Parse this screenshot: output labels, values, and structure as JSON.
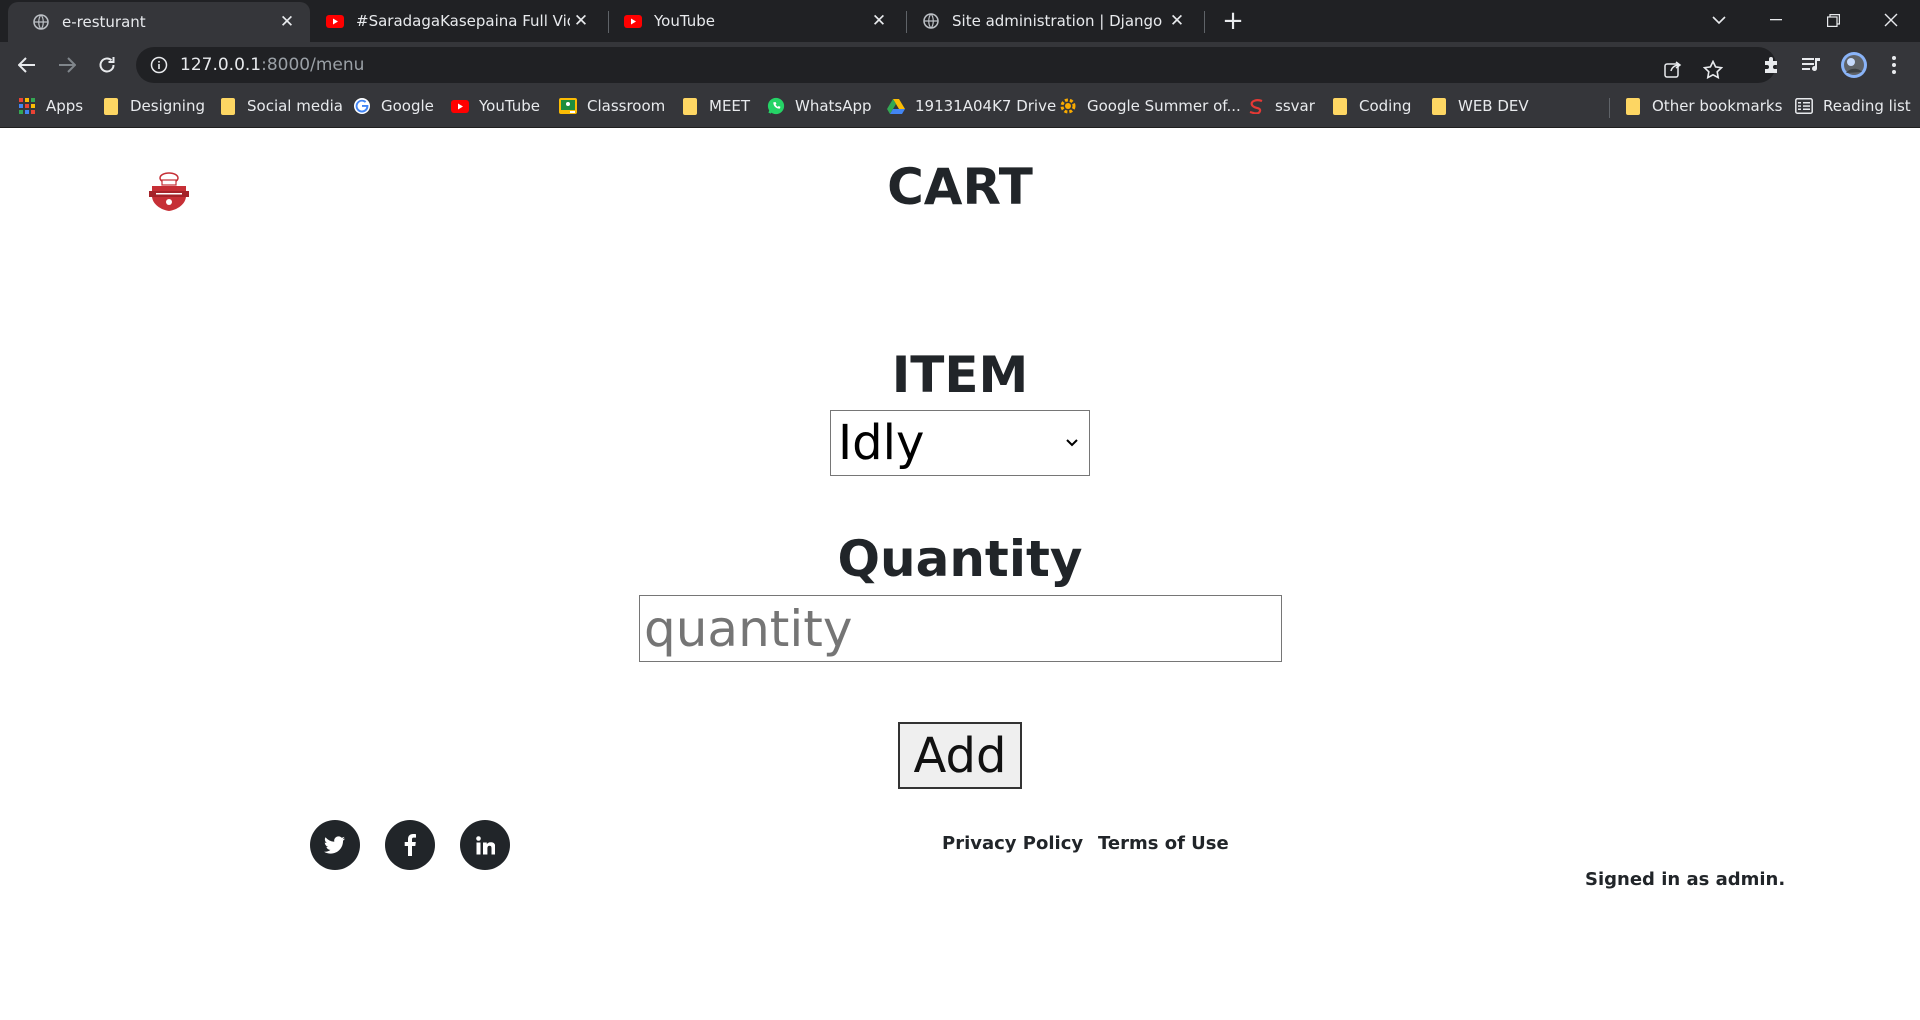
{
  "tabs": [
    {
      "title": "e-resturant",
      "icon": "globe-icon",
      "active": true
    },
    {
      "title": "#SaradagaKasepaina Full Video S",
      "icon": "youtube-icon",
      "active": false
    },
    {
      "title": "YouTube",
      "icon": "youtube-icon",
      "active": false
    },
    {
      "title": "Site administration | Django site a",
      "icon": "globe-icon",
      "active": false
    }
  ],
  "address_bar": {
    "host": "127.0.0.1",
    "path": ":8000/menu"
  },
  "bookmarks": [
    {
      "label": "Apps",
      "icon": "apps-grid-icon"
    },
    {
      "label": "Designing",
      "icon": "folder-icon"
    },
    {
      "label": "Social media",
      "icon": "folder-icon"
    },
    {
      "label": "Google",
      "icon": "google-icon"
    },
    {
      "label": "YouTube",
      "icon": "youtube-icon"
    },
    {
      "label": "Classroom",
      "icon": "classroom-icon"
    },
    {
      "label": "MEET",
      "icon": "folder-icon"
    },
    {
      "label": "WhatsApp",
      "icon": "whatsapp-icon"
    },
    {
      "label": "19131A04K7 Drive",
      "icon": "drive-icon"
    },
    {
      "label": "Google Summer of...",
      "icon": "gsoc-icon"
    },
    {
      "label": "ssvar",
      "icon": "ssvar-icon"
    },
    {
      "label": "Coding",
      "icon": "folder-icon"
    },
    {
      "label": "WEB DEV",
      "icon": "folder-icon"
    },
    {
      "label": "Other bookmarks",
      "icon": "folder-icon"
    },
    {
      "label": "Reading list",
      "icon": "reading-list-icon"
    }
  ],
  "page": {
    "title": "CART",
    "item_label": "ITEM",
    "item_selected": "Idly",
    "quantity_label": "Quantity",
    "quantity_placeholder": "quantity",
    "add_button": "Add",
    "footer": {
      "privacy": "Privacy Policy",
      "terms": "Terms of Use",
      "signed_in": "Signed in as admin."
    }
  },
  "colors": {
    "chrome_dark": "#202124",
    "chrome_toolbar": "#35363a",
    "text_dark": "#212529",
    "logo_red": "#c62f36"
  }
}
